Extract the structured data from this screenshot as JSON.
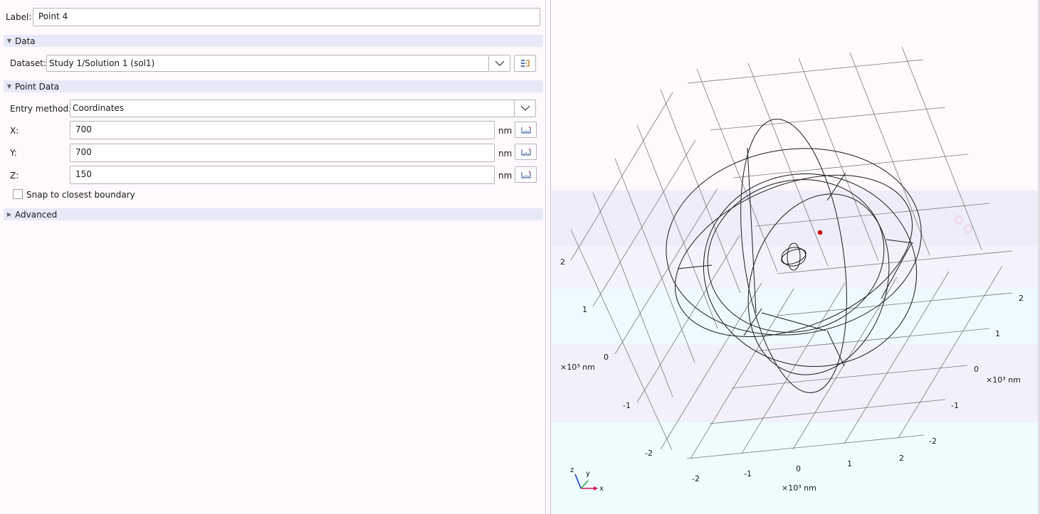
{
  "settings": {
    "label_caption": "Label:",
    "label_value": "Point 4",
    "sections": {
      "data": "Data",
      "point_data": "Point Data",
      "advanced": "Advanced"
    },
    "dataset_caption": "Dataset:",
    "dataset_value": "Study 1/Solution 1 (sol1)",
    "entry_method_caption": "Entry method:",
    "entry_method_value": "Coordinates",
    "x_caption": "X:",
    "x_value": "700",
    "y_caption": "Y:",
    "y_value": "700",
    "z_caption": "Z:",
    "z_value": "150",
    "unit": "nm",
    "snap_label": "Snap to closest boundary",
    "snap_checked": false
  },
  "graphics": {
    "left_axis_ticks": [
      "2",
      "1",
      "0",
      "-1",
      "-2"
    ],
    "right_axis_ticks": [
      "2",
      "1",
      "0",
      "-1",
      "-2"
    ],
    "bottom_axis_ticks": [
      "-2",
      "-1",
      "0",
      "1",
      "2"
    ],
    "axis_unit_left": "×10³ nm",
    "axis_unit_right": "×10³ nm",
    "axis_unit_bottom": "×10³ nm",
    "triad": {
      "z": "z",
      "y": "y",
      "x": "x"
    },
    "point_color": "#cc1010",
    "triad_colors": {
      "x": "#d4145a",
      "y": "#2ba84a",
      "z": "#2040c0"
    }
  },
  "theme": {
    "panel_bg": "#fdf9fd",
    "section_bg": "#e8e9f8",
    "grid_color": "#6f6f6f",
    "wire_color": "#1c1c1c"
  }
}
